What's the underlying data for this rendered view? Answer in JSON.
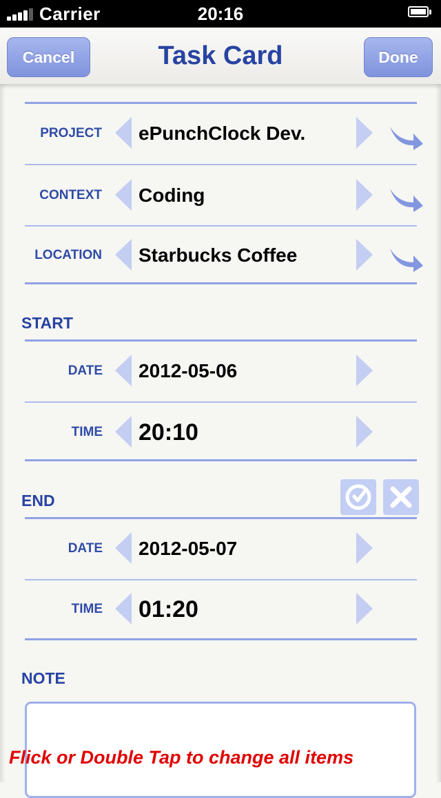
{
  "status_bar": {
    "carrier": "Carrier",
    "time": "20:16"
  },
  "nav": {
    "cancel_label": "Cancel",
    "title": "Task Card",
    "done_label": "Done"
  },
  "fields": {
    "project": {
      "label": "PROJECT",
      "value": "ePunchClock Dev."
    },
    "context": {
      "label": "CONTEXT",
      "value": "Coding"
    },
    "location": {
      "label": "LOCATION",
      "value": "Starbucks Coffee"
    }
  },
  "start": {
    "title": "START",
    "date": {
      "label": "DATE",
      "value": "2012-05-06"
    },
    "time": {
      "label": "TIME",
      "value": "20:10"
    }
  },
  "end": {
    "title": "END",
    "date": {
      "label": "DATE",
      "value": "2012-05-07"
    },
    "time": {
      "label": "TIME",
      "value": "01:20"
    }
  },
  "note": {
    "title": "NOTE",
    "text": ""
  },
  "hint": "Flick or Double Tap to change all items",
  "colors": {
    "accent": "#2743a2",
    "button": "#8fa0e4",
    "rule": "#8fa2e3",
    "hint": "#e00000"
  },
  "icons": [
    "signal-icon",
    "battery-icon",
    "arrow-left-icon",
    "arrow-right-icon",
    "jump-arrow-icon",
    "check-icon",
    "close-icon"
  ]
}
